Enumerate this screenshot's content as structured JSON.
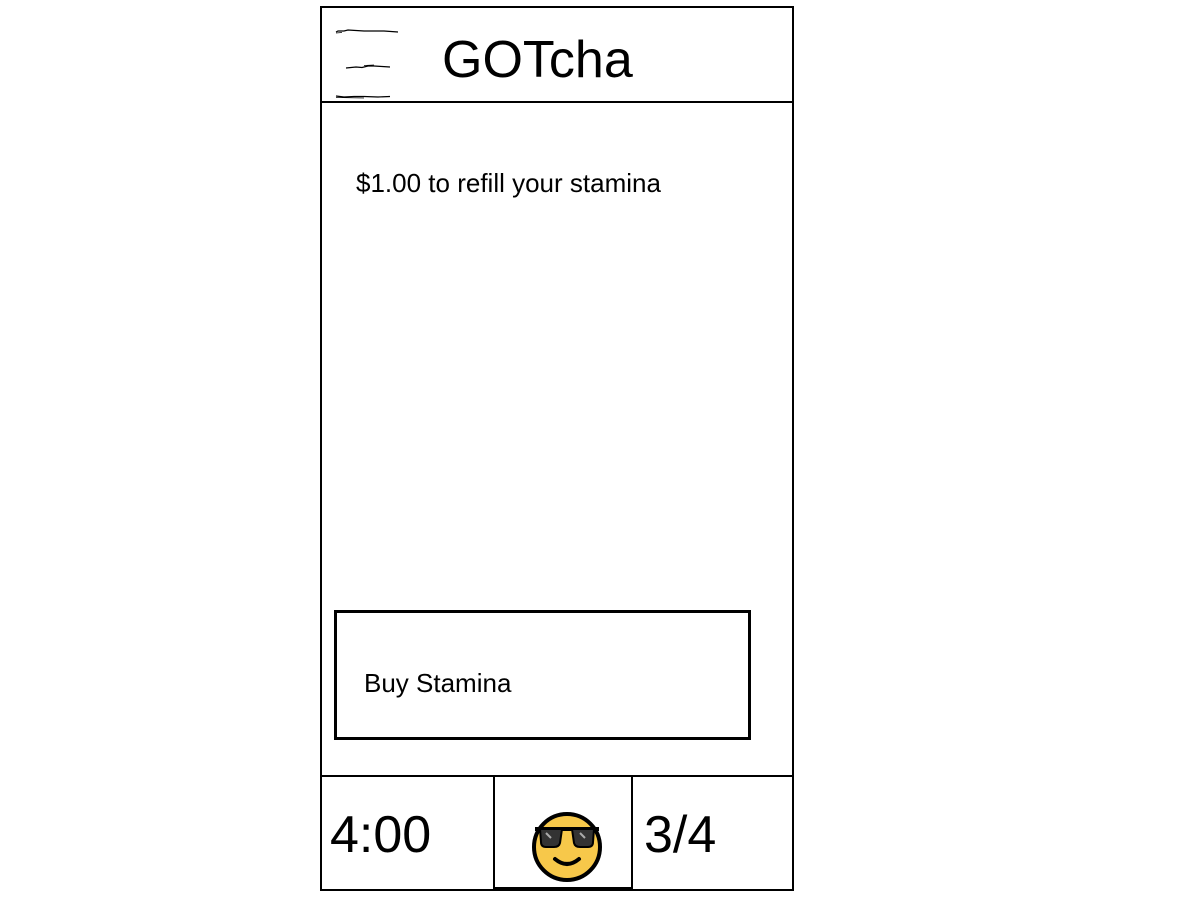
{
  "header": {
    "title": "GOTcha",
    "menu_icon": "hamburger-menu-icon"
  },
  "offer": {
    "text": "$1.00 to refill your stamina"
  },
  "buy_button": {
    "label": "Buy Stamina"
  },
  "footer": {
    "timer": "4:00",
    "avatar_icon": "sunglasses-face-icon",
    "counter": "3/4"
  },
  "colors": {
    "border": "#000000",
    "background": "#ffffff",
    "emoji_face": "#F7C84A",
    "emoji_outline": "#000000"
  }
}
